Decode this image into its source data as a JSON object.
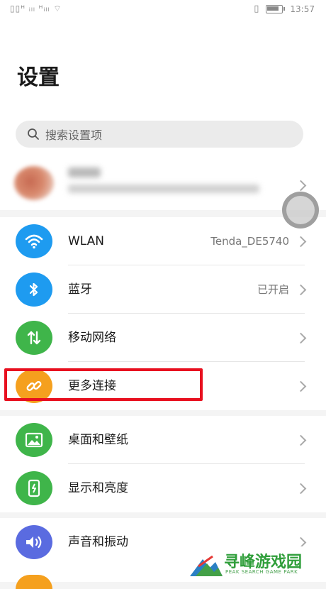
{
  "status_bar": {
    "signal_text": "▯▯ᴴ ᵢₗₗ ᴴᵢₗₗ ⌔",
    "time": "13:57",
    "battery_level": 0.7
  },
  "page": {
    "title": "设置"
  },
  "search": {
    "placeholder": "搜索设置项",
    "icon": "search-icon"
  },
  "account": {
    "name": "",
    "subtitle": ""
  },
  "groups": [
    {
      "items": [
        {
          "label": "WLAN",
          "value": "Tenda_DE5740",
          "icon": "wifi-icon",
          "color": "#1e9bf0"
        },
        {
          "label": "蓝牙",
          "value": "已开启",
          "icon": "bluetooth-icon",
          "color": "#1e9bf0"
        },
        {
          "label": "移动网络",
          "value": "",
          "icon": "mobile-data-icon",
          "color": "#3fb54a"
        },
        {
          "label": "更多连接",
          "value": "",
          "icon": "link-icon",
          "color": "#f5a01e"
        }
      ]
    },
    {
      "items": [
        {
          "label": "桌面和壁纸",
          "value": "",
          "icon": "wallpaper-icon",
          "color": "#3fb54a"
        },
        {
          "label": "显示和亮度",
          "value": "",
          "icon": "display-icon",
          "color": "#3fb54a"
        }
      ]
    },
    {
      "items": [
        {
          "label": "声音和振动",
          "value": "",
          "icon": "sound-icon",
          "color": "#5a6be0"
        }
      ]
    }
  ],
  "watermark": {
    "title": "寻峰游戏园",
    "subtitle": "PEAK SEARCH GAME PARK"
  }
}
